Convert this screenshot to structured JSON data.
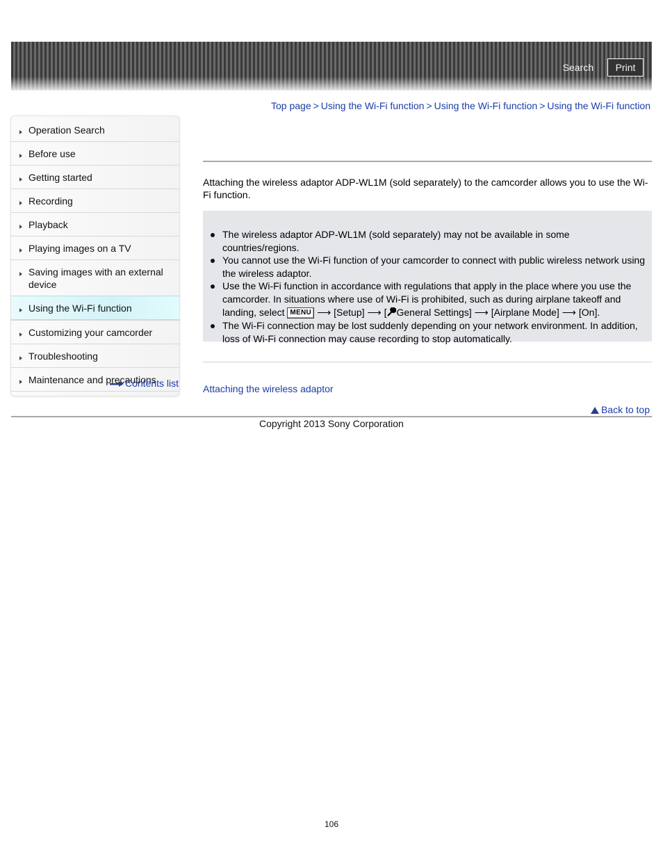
{
  "header": {
    "search_label": "Search",
    "print_label": "Print"
  },
  "breadcrumb": {
    "items": [
      "Top page",
      "Using the Wi-Fi function",
      "Using the Wi-Fi function",
      "Using the Wi-Fi function"
    ],
    "separator": ">"
  },
  "sidebar": {
    "items": [
      {
        "label": "Operation Search"
      },
      {
        "label": "Before use"
      },
      {
        "label": "Getting started"
      },
      {
        "label": "Recording"
      },
      {
        "label": "Playback"
      },
      {
        "label": "Playing images on a TV"
      },
      {
        "label": "Saving images with an external device"
      },
      {
        "label": "Using the Wi-Fi function",
        "active": true
      },
      {
        "label": "Customizing your camcorder"
      },
      {
        "label": "Troubleshooting"
      },
      {
        "label": "Maintenance and precautions"
      }
    ],
    "contents_list_label": "Contents list"
  },
  "main": {
    "intro": "Attaching the wireless adaptor ADP-WL1M (sold separately) to the camcorder allows you to use the Wi-Fi function.",
    "notes": [
      "The wireless adaptor ADP-WL1M (sold separately) may not be available in some countries/regions.",
      "You cannot use the Wi-Fi function of your camcorder to connect with public wireless network using the wireless adaptor.",
      "The Wi-Fi connection may be lost suddenly depending on your network environment. In addition, loss of Wi-Fi connection may cause recording to stop automatically."
    ],
    "note3": {
      "text_before": "Use the Wi-Fi function in accordance with regulations that apply in the place where you use the camcorder. In situations where use of Wi-Fi is prohibited, such as during airplane takeoff and landing, select ",
      "menu_icon_label": "MENU",
      "arrow": "⟶",
      "step1": "[Setup]",
      "step2_open": "[",
      "step2_label": "General Settings]",
      "step3": "[Airplane Mode]",
      "step4": "[On]."
    },
    "related_link": "Attaching the wireless adaptor",
    "back_to_top": "Back to top"
  },
  "footer": {
    "copyright": "Copyright 2013 Sony Corporation",
    "page_number": "106"
  }
}
